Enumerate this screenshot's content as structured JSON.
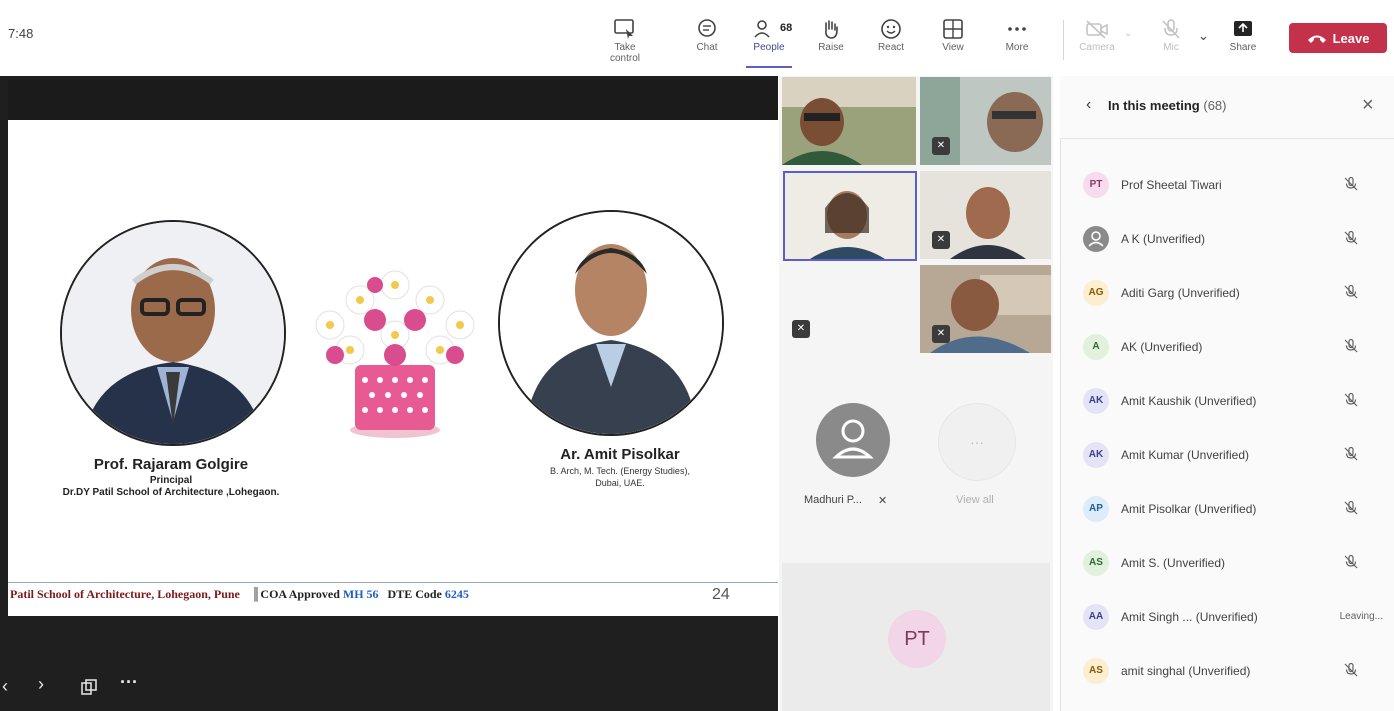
{
  "topbar": {
    "time": "7:48",
    "buttons": [
      {
        "label": "Take control",
        "icon": "take-control-icon"
      },
      {
        "label": "Chat",
        "icon": "chat-icon"
      },
      {
        "label": "People",
        "icon": "people-icon",
        "badge": "68"
      },
      {
        "label": "Raise",
        "icon": "raise-hand-icon"
      },
      {
        "label": "React",
        "icon": "react-icon"
      },
      {
        "label": "View",
        "icon": "view-icon"
      },
      {
        "label": "More",
        "icon": "more-icon"
      },
      {
        "label": "Camera",
        "icon": "camera-off-icon"
      },
      {
        "label": "Mic",
        "icon": "mic-off-icon"
      },
      {
        "label": "Share",
        "icon": "share-icon"
      }
    ],
    "leave_label": "Leave",
    "leave_color": "#c4314b",
    "accent_color": "#5b5fc7"
  },
  "slide": {
    "left_person": {
      "name": "Prof. Rajaram Golgire",
      "title": "Principal",
      "org": "Dr.DY Patil School of Architecture ,Lohegaon."
    },
    "right_person": {
      "name": "Ar. Amit Pisolkar",
      "credentials": "B. Arch, M. Tech. (Energy Studies),",
      "location": "Dubai, UAE."
    },
    "footer": {
      "school": "Patil School of Architecture, Lohegaon, Pune",
      "coa_label": "COA Approved",
      "coa_value": "MH 56",
      "dte_label": "DTE Code",
      "dte_value": "6245"
    },
    "page_number": "24"
  },
  "gallery": {
    "madhuri_name": "Madhuri P...",
    "view_all_label": "View all",
    "pt_initials": "PT"
  },
  "panel": {
    "title": "In this meeting",
    "count": "(68)",
    "participants": [
      {
        "initials": "PT",
        "name": "Prof Sheetal Tiwari",
        "bg": "#f6dcec",
        "fg": "#8a3a6a",
        "status": "muted"
      },
      {
        "initials": "",
        "name": "A K (Unverified)",
        "bg": "#8a8a8a",
        "fg": "#ffffff",
        "status": "muted"
      },
      {
        "initials": "AG",
        "name": "Aditi Garg (Unverified)",
        "bg": "#fbeed1",
        "fg": "#8a5a00",
        "status": "muted"
      },
      {
        "initials": "A",
        "name": "AK (Unverified)",
        "bg": "#e2f1de",
        "fg": "#2f6b2a",
        "status": "muted"
      },
      {
        "initials": "AK",
        "name": "Amit Kaushik (Unverified)",
        "bg": "#e3e5f6",
        "fg": "#3b3f8f",
        "status": "muted"
      },
      {
        "initials": "AK",
        "name": "Amit Kumar (Unverified)",
        "bg": "#e3e5f6",
        "fg": "#3b3f8f",
        "status": "muted"
      },
      {
        "initials": "AP",
        "name": "Amit Pisolkar (Unverified)",
        "bg": "#dcecf9",
        "fg": "#1f5f99",
        "status": "muted"
      },
      {
        "initials": "AS",
        "name": "Amit S. (Unverified)",
        "bg": "#e2f1de",
        "fg": "#2f6b2a",
        "status": "muted"
      },
      {
        "initials": "AA",
        "name": "Amit Singh ... (Unverified)",
        "bg": "#e3e5f6",
        "fg": "#3b3f8f",
        "status": "Leaving..."
      },
      {
        "initials": "AS",
        "name": "amit singhal (Unverified)",
        "bg": "#fbeed1",
        "fg": "#8a5a00",
        "status": "muted"
      }
    ]
  }
}
